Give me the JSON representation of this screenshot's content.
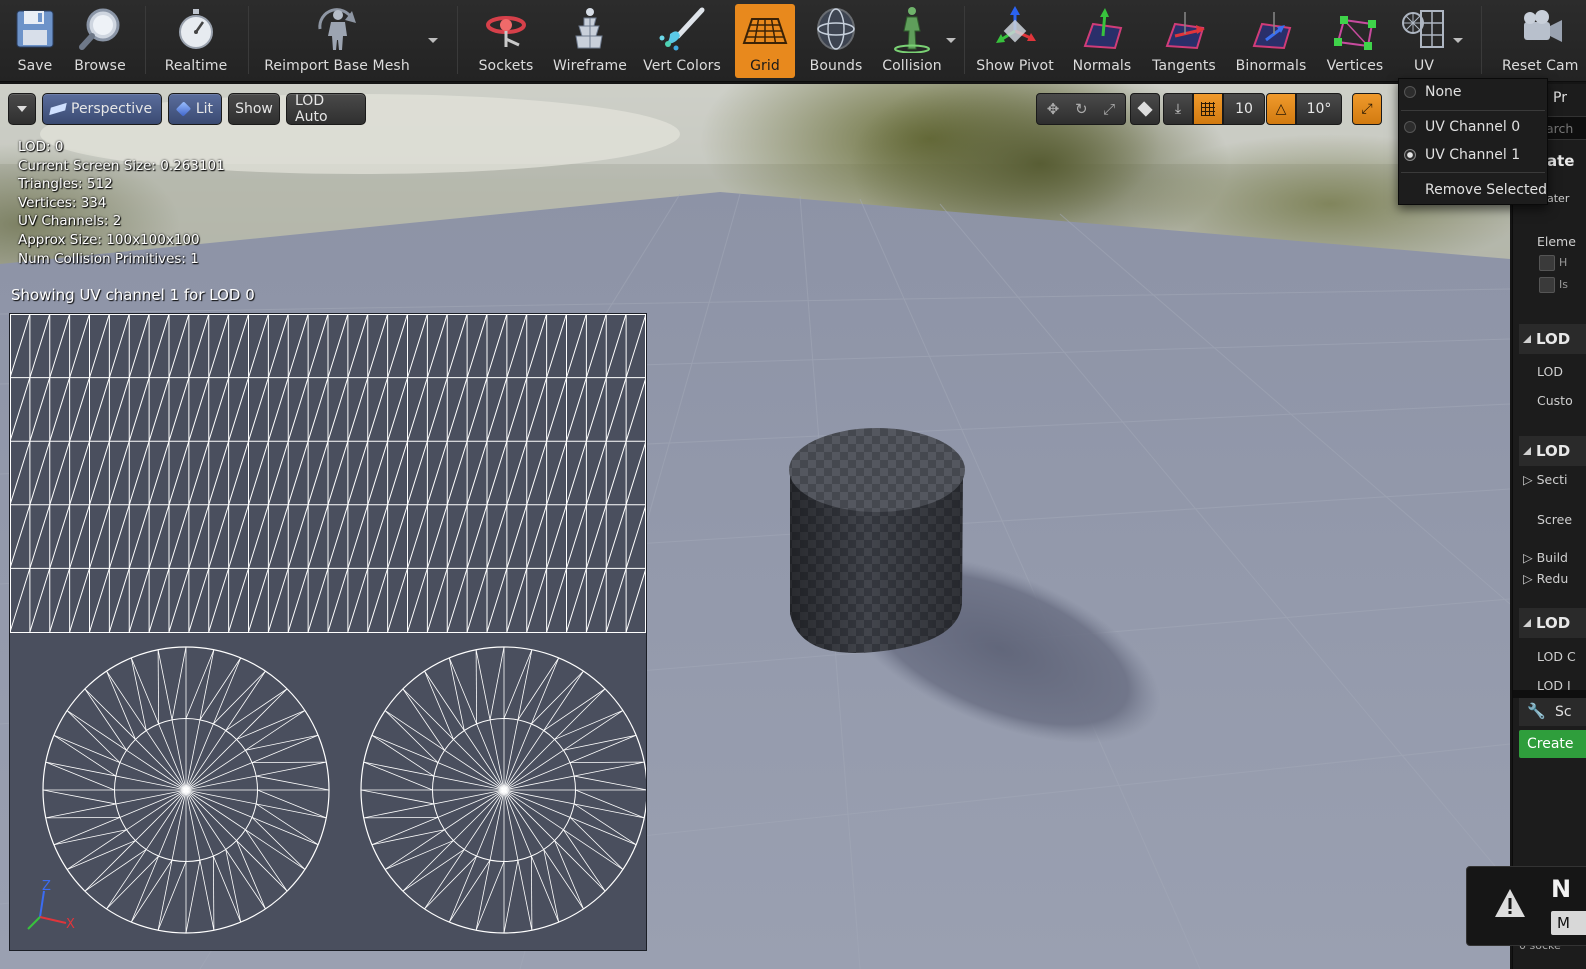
{
  "toolbar": {
    "save": "Save",
    "browse": "Browse",
    "realtime": "Realtime",
    "reimport": "Reimport Base Mesh",
    "sockets": "Sockets",
    "wireframe": "Wireframe",
    "vert_colors": "Vert Colors",
    "grid": "Grid",
    "bounds": "Bounds",
    "collision": "Collision",
    "show_pivot": "Show Pivot",
    "normals": "Normals",
    "tangents": "Tangents",
    "binormals": "Binormals",
    "vertices": "Vertices",
    "uv": "UV",
    "reset_camera": "Reset Cam"
  },
  "viewport": {
    "perspective": "Perspective",
    "lit": "Lit",
    "show": "Show",
    "lod_auto": "LOD Auto",
    "grid_snap": "10",
    "rot_snap": "10°"
  },
  "stats": {
    "lod": "LOD:  0",
    "screen_size": "Current Screen Size:  0.263101",
    "triangles": "Triangles:  512",
    "vertices": "Vertices:  334",
    "uv_channels": "UV Channels:  2",
    "approx_size": "Approx Size: 100x100x100",
    "collision": "Num Collision Primitives:  1"
  },
  "uv_caption": "Showing UV channel 1 for LOD 0",
  "axis": {
    "z": "Z",
    "x": "X"
  },
  "uv_menu": {
    "none": "None",
    "ch0": "UV Channel 0",
    "ch1": "UV Channel 1",
    "remove": "Remove Selected",
    "selected": "UV Channel 1"
  },
  "details": {
    "pr": "Pr",
    "search": "arch",
    "ate": "ate",
    "mater": "ater",
    "element": "Eleme",
    "h": "H",
    "is": "Is",
    "lod1": "LOD",
    "lod_label": "LOD",
    "custom": "Custo",
    "lod2": "LOD",
    "section": "Secti",
    "screen": "Scree",
    "build": "Build",
    "reduce": "Redu",
    "lod3": "LOD",
    "lod_c": "LOD C",
    "lod_i": "LOD I",
    "socket": "Sc",
    "create": "Create",
    "toast_n": "N",
    "toast_m": "M",
    "sockets_count": "0 socke"
  },
  "colors": {
    "accent": "#e8891d",
    "create_green": "#2f9e3c"
  }
}
